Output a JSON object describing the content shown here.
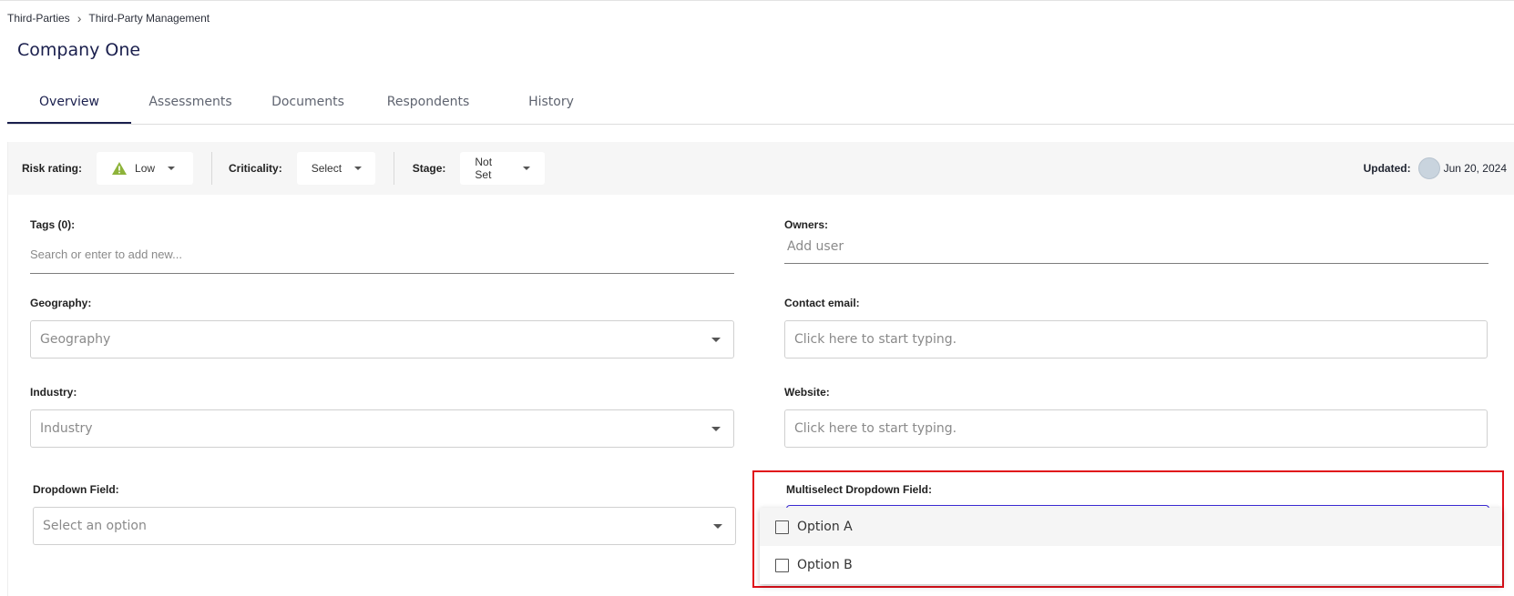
{
  "breadcrumb": {
    "parent": "Third-Parties",
    "current": "Third-Party Management"
  },
  "page": {
    "title": "Company One"
  },
  "tabs": [
    {
      "label": "Overview"
    },
    {
      "label": "Assessments"
    },
    {
      "label": "Documents"
    },
    {
      "label": "Respondents"
    },
    {
      "label": "History"
    }
  ],
  "toolbar": {
    "risk_label": "Risk rating:",
    "risk_value": "Low",
    "criticality_label": "Criticality:",
    "criticality_value": "Select",
    "stage_label": "Stage:",
    "stage_value": "Not Set",
    "updated_label": "Updated:",
    "updated_value": "Jun 20, 2024"
  },
  "fields": {
    "tags_label": "Tags (0):",
    "tags_placeholder": "Search or enter to add new...",
    "owners_label": "Owners:",
    "owners_placeholder": "Add user",
    "geography_label": "Geography:",
    "geography_placeholder": "Geography",
    "contact_label": "Contact email:",
    "contact_placeholder": "Click here to start typing.",
    "industry_label": "Industry:",
    "industry_placeholder": "Industry",
    "website_label": "Website:",
    "website_placeholder": "Click here to start typing.",
    "dropdown_label": "Dropdown Field:",
    "dropdown_placeholder": "Select an option",
    "multiselect_label": "Multiselect Dropdown Field:",
    "multiselect_options": [
      "Option A",
      "Option B"
    ]
  },
  "colors": {
    "accent": "#1a1f4d",
    "focus": "#3b2bd6",
    "highlight": "#e0101a",
    "warning": "#8db33a"
  }
}
